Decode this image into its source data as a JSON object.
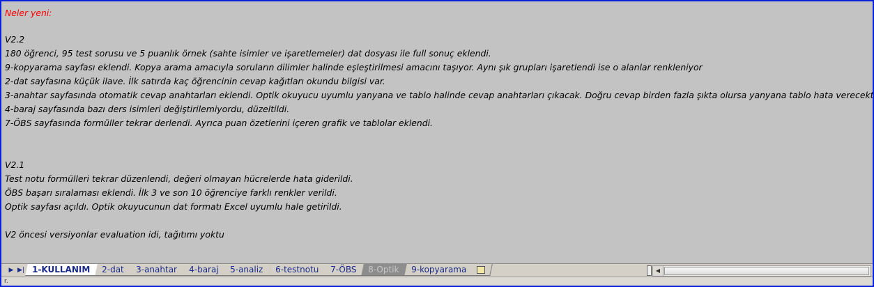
{
  "content": {
    "heading": "Neler yeni:",
    "v22": {
      "title": "V2.2",
      "lines": [
        "180 öğrenci, 95 test sorusu ve 5 puanlık örnek (sahte isimler ve işaretlemeler) dat dosyası ile full sonuç eklendi.",
        "9-kopyarama sayfası eklendi. Kopya arama amacıyla soruların dilimler halinde eşleştirilmesi amacını taşıyor. Aynı şık grupları işaretlendi ise o alanlar renkleniyor",
        "2-dat sayfasına küçük ilave. İlk satırda kaç öğrencinin cevap kağıtları okundu bilgisi var.",
        "3-anahtar sayfasında otomatik cevap anahtarları eklendi. Optik okuyucu uyumlu yanyana ve tablo halinde cevap anahtarları çıkacak. Doğru cevap birden fazla şıkta olursa yanyana tablo hata verecektir.",
        "4-baraj sayfasında bazı ders isimleri değiştirilemiyordu, düzeltildi.",
        "7-ÖBS sayfasında formüller tekrar derlendi. Ayrıca puan özetlerini içeren grafik ve tablolar eklendi."
      ]
    },
    "v21": {
      "title": "V2.1",
      "lines": [
        "Test notu formülleri tekrar düzenlendi, değeri olmayan hücrelerde hata giderildi.",
        "ÖBS başarı sıralaması eklendi. İlk 3 ve son 10 öğrenciye farklı renkler verildi.",
        "Optik sayfası açıldı. Optik okuyucunun dat formatı Excel uyumlu hale getirildi."
      ]
    },
    "note": "V2 öncesi versiyonlar evaluation idi, tağıtımı yoktu"
  },
  "tabs": [
    {
      "label": "1-KULLANIM",
      "state": "active"
    },
    {
      "label": "2-dat",
      "state": "normal"
    },
    {
      "label": "3-anahtar",
      "state": "normal"
    },
    {
      "label": "4-baraj",
      "state": "normal"
    },
    {
      "label": "5-analiz",
      "state": "normal"
    },
    {
      "label": "6-testnotu",
      "state": "normal"
    },
    {
      "label": "7-ÖBS",
      "state": "normal"
    },
    {
      "label": "8-Optik",
      "state": "dim"
    },
    {
      "label": "9-kopyarama",
      "state": "normal"
    }
  ],
  "nav": {
    "next_icon": "▶",
    "last_icon": "▶|"
  },
  "status": {
    "text": "r."
  },
  "colors": {
    "heading": "#ff0000",
    "sheet_bg": "#c3c3c3",
    "frame": "#0a1fd9",
    "tab_text": "#1a2a8a"
  }
}
